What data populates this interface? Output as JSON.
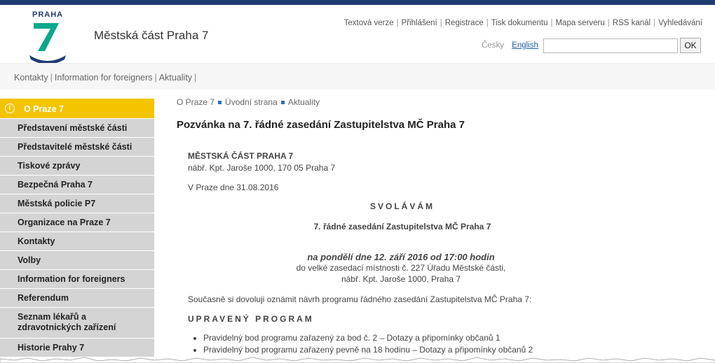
{
  "logo": {
    "text": "PRAHA",
    "number": "7"
  },
  "site_title": "Městská část Praha 7",
  "top_links": [
    "Textová verze",
    "Přihlášení",
    "Registrace",
    "Tisk dokumentu",
    "Mapa serveru",
    "RSS kanál",
    "Vyhledávání"
  ],
  "lang": {
    "cz": "Česky",
    "en": "English"
  },
  "search": {
    "button": "OK",
    "value": ""
  },
  "nav": [
    "Kontakty",
    "Information for foreigners",
    "Aktuality"
  ],
  "sidebar": {
    "head": "O Praze 7",
    "items": [
      "Představení městské části",
      "Představitelé městské části",
      "Tiskové zprávy",
      "Bezpečná Praha 7",
      "Městská policie P7",
      "Organizace na Praze 7",
      "Kontakty",
      "Volby",
      "Information for foreigners",
      "Referendum",
      "Seznam lékařů a zdravotnických zařízení",
      "Historie Prahy 7"
    ]
  },
  "breadcrumb": [
    "O Praze 7",
    "Úvodní strana",
    "Aktuality"
  ],
  "article": {
    "title": "Pozvánka na 7. řádné zasedání Zastupitelstva MČ Praha 7",
    "org": "MĚSTSKÁ  ČÁST  PRAHA 7",
    "address": "nábř. Kpt. Jaroše 1000, 170 05 Praha 7",
    "date_line": "V Praze  dne  31.08.2016",
    "convene": "SVOLÁVÁM",
    "session": "7. řádné zasedání Zastupitelstva MČ Praha 7",
    "when": "na pondělí dne  12. září  2016  od 17:00 hodin",
    "where1": "do velké zasedací místnosti č. 227 Úřadu Městské části,",
    "where2": "nábř. Kpt. Jaroše 1000, Praha 7",
    "intro": "Současně si dovoluji oznámit návrh programu řádného zasedání Zastupitelstva MČ Praha 7:",
    "program_title": "UPRAVENÝ  PROGRAM",
    "program": [
      "Pravidelný bod programu zařazený za bod č. 2 – Dotazy a připomínky občanů 1",
      "Pravidelný bod programu zařazený pevně na 18 hodinu – Dotazy a připomínky občanů 2"
    ]
  },
  "colors": {
    "brand_blue": "#1f3a73",
    "accent_green": "#0aa88c",
    "sidebar_yellow": "#f5c400",
    "sidebar_gray": "#d4d4d4"
  }
}
